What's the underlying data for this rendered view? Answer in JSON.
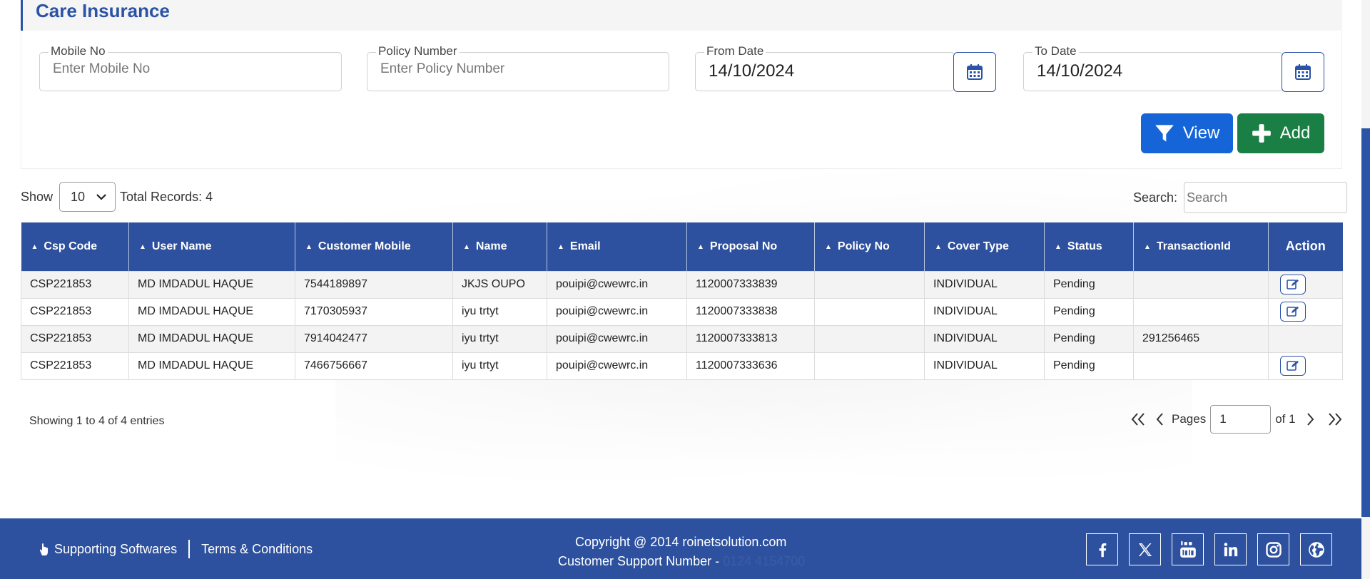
{
  "page": {
    "title": "Care Insurance"
  },
  "filters": {
    "mobile": {
      "label": "Mobile No",
      "placeholder": "Enter Mobile No",
      "value": ""
    },
    "policy": {
      "label": "Policy Number",
      "placeholder": "Enter Policy Number",
      "value": ""
    },
    "from_date": {
      "label": "From Date",
      "value": "14/10/2024"
    },
    "to_date": {
      "label": "To Date",
      "value": "14/10/2024"
    },
    "view_label": "View",
    "add_label": "Add"
  },
  "list_controls": {
    "show_label": "Show",
    "page_size": "10",
    "total_records": "Total Records: 4",
    "search_label": "Search:",
    "search_placeholder": "Search"
  },
  "table": {
    "columns": [
      "Csp Code",
      "User Name",
      "Customer Mobile",
      "Name",
      "Email",
      "Proposal No",
      "Policy No",
      "Cover Type",
      "Status",
      "TransactionId",
      "Action"
    ],
    "rows": [
      {
        "csp": "CSP221853",
        "user": "MD IMDADUL HAQUE",
        "mobile": "7544189897",
        "name": "JKJS OUPO",
        "email": "pouipi@cwewrc.in",
        "proposal": "1120007333839",
        "policy": "",
        "cover": "INDIVIDUAL",
        "status": "Pending",
        "txn": "",
        "editable": true
      },
      {
        "csp": "CSP221853",
        "user": "MD IMDADUL HAQUE",
        "mobile": "7170305937",
        "name": "iyu trtyt",
        "email": "pouipi@cwewrc.in",
        "proposal": "1120007333838",
        "policy": "",
        "cover": "INDIVIDUAL",
        "status": "Pending",
        "txn": "",
        "editable": true
      },
      {
        "csp": "CSP221853",
        "user": "MD IMDADUL HAQUE",
        "mobile": "7914042477",
        "name": "iyu trtyt",
        "email": "pouipi@cwewrc.in",
        "proposal": "1120007333813",
        "policy": "",
        "cover": "INDIVIDUAL",
        "status": "Pending",
        "txn": "291256465",
        "editable": false
      },
      {
        "csp": "CSP221853",
        "user": "MD IMDADUL HAQUE",
        "mobile": "7466756667",
        "name": "iyu trtyt",
        "email": "pouipi@cwewrc.in",
        "proposal": "1120007333636",
        "policy": "",
        "cover": "INDIVIDUAL",
        "status": "Pending",
        "txn": "",
        "editable": true
      }
    ]
  },
  "pagination": {
    "entries_text": "Showing 1 to 4 of 4 entries",
    "pages_label": "Pages",
    "current_page": "1",
    "of_label": "of 1"
  },
  "footer": {
    "supporting_softwares": "Supporting Softwares",
    "terms": "Terms & Conditions",
    "copyright": "Copyright @ 2014 roinetsolution.com",
    "support_label": "Customer Support Number -",
    "support_number": "0124 4154700",
    "social_icons": [
      "facebook-icon",
      "x-twitter-icon",
      "youtube-icon",
      "linkedin-icon",
      "instagram-icon",
      "globe-icon"
    ]
  },
  "colors": {
    "brand": "#2d519e",
    "view_button": "#1565d8",
    "add_button": "#1a7f44"
  }
}
